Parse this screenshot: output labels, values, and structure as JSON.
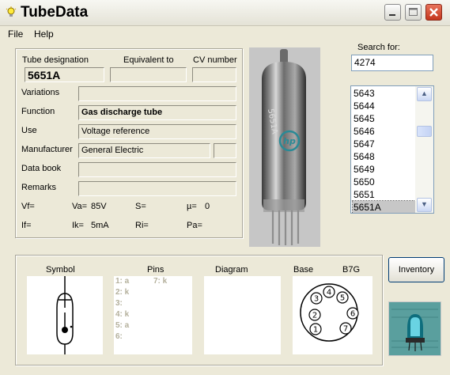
{
  "window": {
    "title": "TubeData"
  },
  "menu": {
    "file": "File",
    "help": "Help"
  },
  "form": {
    "designation_label": "Tube designation",
    "equivalent_label": "Equivalent to",
    "cv_label": "CV number",
    "designation": "5651A",
    "equivalent": "",
    "cv_number": "",
    "variations_label": "Variations",
    "variations": "",
    "function_label": "Function",
    "function": "Gas discharge tube",
    "use_label": "Use",
    "use": "Voltage reference",
    "manufacturer_label": "Manufacturer",
    "manufacturer": "General Electric",
    "manufacturer_extra": "",
    "databook_label": "Data book",
    "databook": "",
    "remarks_label": "Remarks",
    "remarks": "",
    "params": {
      "vf_label": "Vf=",
      "vf": "",
      "va_label": "Va=",
      "va": "85V",
      "s_label": "S=",
      "s": "",
      "mu_label": "µ=",
      "mu": "0",
      "if_label": "If=",
      "if": "",
      "ik_label": "Ik=",
      "ik": "5mA",
      "ri_label": "Ri=",
      "ri": "",
      "pa_label": "Pa=",
      "pa": ""
    }
  },
  "search": {
    "label": "Search for:",
    "value": "4274",
    "items": [
      "5643",
      "5644",
      "5645",
      "5646",
      "5647",
      "5648",
      "5649",
      "5650",
      "5651",
      "5651A"
    ],
    "selected_index": 9
  },
  "bottom": {
    "symbol_label": "Symbol",
    "pins_label": "Pins",
    "diagram_label": "Diagram",
    "base_label": "Base",
    "base_type": "B7G",
    "pins_left": [
      "1: a",
      "2: k",
      "3:",
      "4: k",
      "5: a",
      "6:"
    ],
    "pins_right": [
      "7: k"
    ],
    "base_pins": [
      "1",
      "2",
      "3",
      "4",
      "5",
      "6",
      "7"
    ],
    "inventory_label": "Inventory"
  },
  "photo": {
    "logo_text": "hp",
    "tube_marking": "5651A"
  },
  "icons": {
    "app": "lightbulb-icon",
    "minimize": "minimize-icon",
    "maximize": "maximize-icon",
    "close": "close-icon"
  }
}
